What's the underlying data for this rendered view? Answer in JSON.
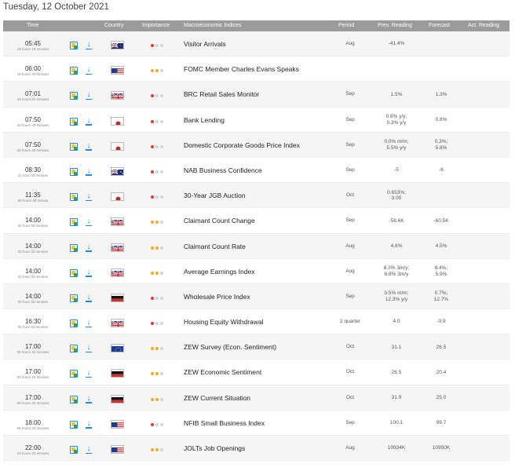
{
  "page": {
    "date": "Tuesday, 12 October 2021"
  },
  "colors": {
    "header_bg": "#9b9b9b",
    "importance_high": "#e53935",
    "importance_medium": "#f9a825",
    "importance_low": "#d5d5d5",
    "calendar_icon": "#1e88e5",
    "download_icon": "#1e88e5"
  },
  "table": {
    "headers": {
      "time": "Time",
      "country": "Country",
      "importance": "Importance",
      "indicator": "Macroeconomic Indices",
      "period": "Period",
      "prev": "Prev. Reading",
      "forecast": "Forecast",
      "actual": "Act. Reading"
    },
    "rows": [
      {
        "time": "05:45",
        "countdown": "18 hours 18 minutes",
        "country": "NZ",
        "importance": 1,
        "indicator": "Visitor Arrivals",
        "period": "Aug",
        "prev": [
          "-41.4%"
        ],
        "forecast": [
          ""
        ],
        "actual": ""
      },
      {
        "time": "06:00",
        "countdown": "18 hours 33 minutes",
        "country": "US",
        "importance": 2,
        "indicator": "FOMC Member Charles Evans Speaks",
        "period": "",
        "prev": [
          ""
        ],
        "forecast": [
          ""
        ],
        "actual": ""
      },
      {
        "time": "07:01",
        "countdown": "19 hours 34 minutes",
        "country": "UK",
        "importance": 1,
        "indicator": "BRC Retail Sales Monitor",
        "period": "Sep",
        "prev": [
          "1.5%"
        ],
        "forecast": [
          "1.3%"
        ],
        "actual": ""
      },
      {
        "time": "07:50",
        "countdown": "20 hours 23 minutes",
        "country": "JP",
        "importance": 1,
        "indicator": "Bank Lending",
        "period": "Sep",
        "prev": [
          "0.6% y/y;",
          "0.3% y/y"
        ],
        "forecast": [
          "0.8%"
        ],
        "actual": ""
      },
      {
        "time": "07:50",
        "countdown": "20 hours 23 minutes",
        "country": "JP",
        "importance": 1,
        "indicator": "Domestic Corporate Goods Price Index",
        "period": "Sep",
        "prev": [
          "0.0% m/m;",
          "5.5% y/y"
        ],
        "forecast": [
          "0.3%;",
          "5.8%"
        ],
        "actual": ""
      },
      {
        "time": "08:30",
        "countdown": "21 hour 03 minutes",
        "country": "AU",
        "importance": 1,
        "indicator": "NAB Business Confidence",
        "period": "Sep",
        "prev": [
          "-5"
        ],
        "forecast": [
          "-6"
        ],
        "actual": ""
      },
      {
        "time": "11:35",
        "countdown": "00 hours 08 minute",
        "country": "JP",
        "importance": 1,
        "indicator": "30-Year JGB Auction",
        "period": "Oct",
        "prev": [
          "0.653%;",
          "3.00"
        ],
        "forecast": [
          ""
        ],
        "actual": ""
      },
      {
        "time": "14:00",
        "countdown": "02 hour 33 minutes",
        "country": "UK",
        "importance": 2,
        "indicator": "Claimant Count Change",
        "period": "Sep",
        "prev": [
          "-58.6K"
        ],
        "forecast": [
          "-60.5K"
        ],
        "actual": ""
      },
      {
        "time": "14:00",
        "countdown": "02 hour 33 minutes",
        "country": "UK",
        "importance": 2,
        "indicator": "Claimant Count Rate",
        "period": "Aug",
        "prev": [
          "4.6%"
        ],
        "forecast": [
          "4.5%"
        ],
        "actual": ""
      },
      {
        "time": "14:00",
        "countdown": "02 hour 33 minutes",
        "country": "UK",
        "importance": 2,
        "indicator": "Average Earnings Index",
        "period": "Aug",
        "prev": [
          "8.3% 3m/y;",
          "6.8% 3m/y"
        ],
        "forecast": [
          "8.4%;",
          "5.9%"
        ],
        "actual": ""
      },
      {
        "time": "14:00",
        "countdown": "02 hour 33 minutes",
        "country": "DE",
        "importance": 1,
        "indicator": "Wholesale Price Index",
        "period": "Sep",
        "prev": [
          "0.5% m/m;",
          "12.3% y/y"
        ],
        "forecast": [
          "0.7%;",
          "12.7%"
        ],
        "actual": ""
      },
      {
        "time": "16:30",
        "countdown": "05 hour 03 minutes",
        "country": "UK",
        "importance": 1,
        "indicator": "Housing Equity Withdrawal",
        "period": "2 quarter",
        "prev": [
          "4.0"
        ],
        "forecast": [
          "-0.9"
        ],
        "actual": ""
      },
      {
        "time": "17:00",
        "countdown": "05 hours 33 minutes",
        "country": "EU",
        "importance": 2,
        "indicator": "ZEW Survey (Econ. Sentiment)",
        "period": "Oct",
        "prev": [
          "31.1"
        ],
        "forecast": [
          "26.5"
        ],
        "actual": ""
      },
      {
        "time": "17:00",
        "countdown": "05 hours 33 minutes",
        "country": "DE",
        "importance": 2,
        "indicator": "ZEW Economic Sentiment",
        "period": "Oct",
        "prev": [
          "26.5"
        ],
        "forecast": [
          "20.4"
        ],
        "actual": ""
      },
      {
        "time": "17:00",
        "countdown": "05 hours 33 minutes",
        "country": "DE",
        "importance": 2,
        "indicator": "ZEW Current Situation",
        "period": "Oct",
        "prev": [
          "31.9"
        ],
        "forecast": [
          "25.0"
        ],
        "actual": ""
      },
      {
        "time": "18:00",
        "countdown": "06 hours 33 minutes",
        "country": "US",
        "importance": 1,
        "indicator": "NFIB Small Business Index",
        "period": "Sep",
        "prev": [
          "100.1"
        ],
        "forecast": [
          "99.7"
        ],
        "actual": ""
      },
      {
        "time": "22:00",
        "countdown": "10 hours 33 minutes",
        "country": "US",
        "importance": 2,
        "indicator": "JOLTs Job Openings",
        "period": "Aug",
        "prev": [
          "10934K"
        ],
        "forecast": [
          "10950K"
        ],
        "actual": ""
      }
    ]
  }
}
